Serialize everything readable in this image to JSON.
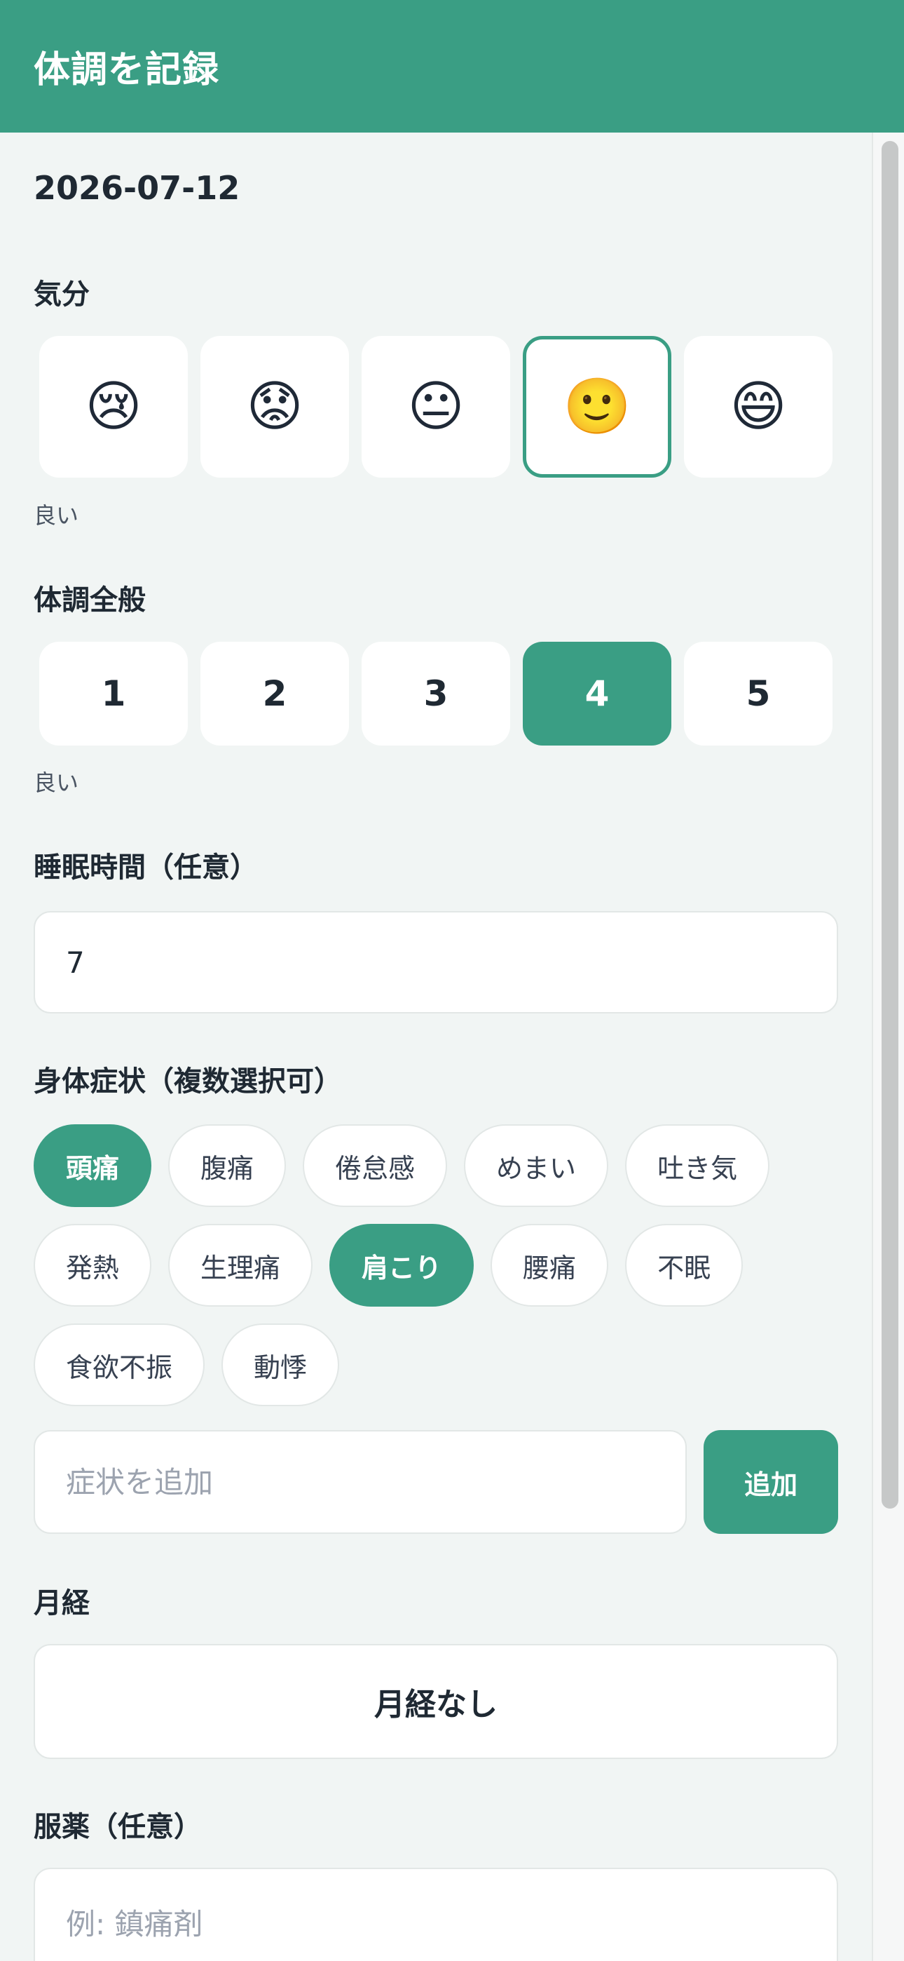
{
  "header": {
    "title": "体調を記録"
  },
  "date": "2026-07-12",
  "mood": {
    "label": "気分",
    "options": [
      {
        "emoji": "😢",
        "icon": "crying-face-icon"
      },
      {
        "emoji": "😟",
        "icon": "worried-face-icon"
      },
      {
        "emoji": "😐",
        "icon": "neutral-face-icon"
      },
      {
        "emoji": "🙂",
        "icon": "slightly-smiling-face-icon"
      },
      {
        "emoji": "😄",
        "icon": "grinning-face-icon"
      }
    ],
    "selected_index": 3,
    "selected_text": "良い"
  },
  "condition": {
    "label": "体調全般",
    "options": [
      "1",
      "2",
      "3",
      "4",
      "5"
    ],
    "selected_index": 3,
    "selected_text": "良い"
  },
  "sleep": {
    "label": "睡眠時間（任意）",
    "value": "7"
  },
  "symptoms": {
    "label": "身体症状（複数選択可）",
    "rows": [
      [
        {
          "label": "頭痛",
          "selected": true
        },
        {
          "label": "腹痛",
          "selected": false
        },
        {
          "label": "倦怠感",
          "selected": false
        },
        {
          "label": "めまい",
          "selected": false
        },
        {
          "label": "吐き気",
          "selected": false
        }
      ],
      [
        {
          "label": "発熱",
          "selected": false
        },
        {
          "label": "生理痛",
          "selected": false
        },
        {
          "label": "肩こり",
          "selected": true
        },
        {
          "label": "腰痛",
          "selected": false
        },
        {
          "label": "不眠",
          "selected": false
        }
      ],
      [
        {
          "label": "食欲不振",
          "selected": false
        },
        {
          "label": "動悸",
          "selected": false
        }
      ]
    ],
    "add_placeholder": "症状を追加",
    "add_button": "追加"
  },
  "menstruation": {
    "label": "月経",
    "value": "月経なし"
  },
  "medication": {
    "label": "服薬（任意）",
    "placeholder": "例: 鎮痛剤"
  },
  "colors": {
    "accent": "#3a9e84",
    "background": "#f1f5f4"
  }
}
